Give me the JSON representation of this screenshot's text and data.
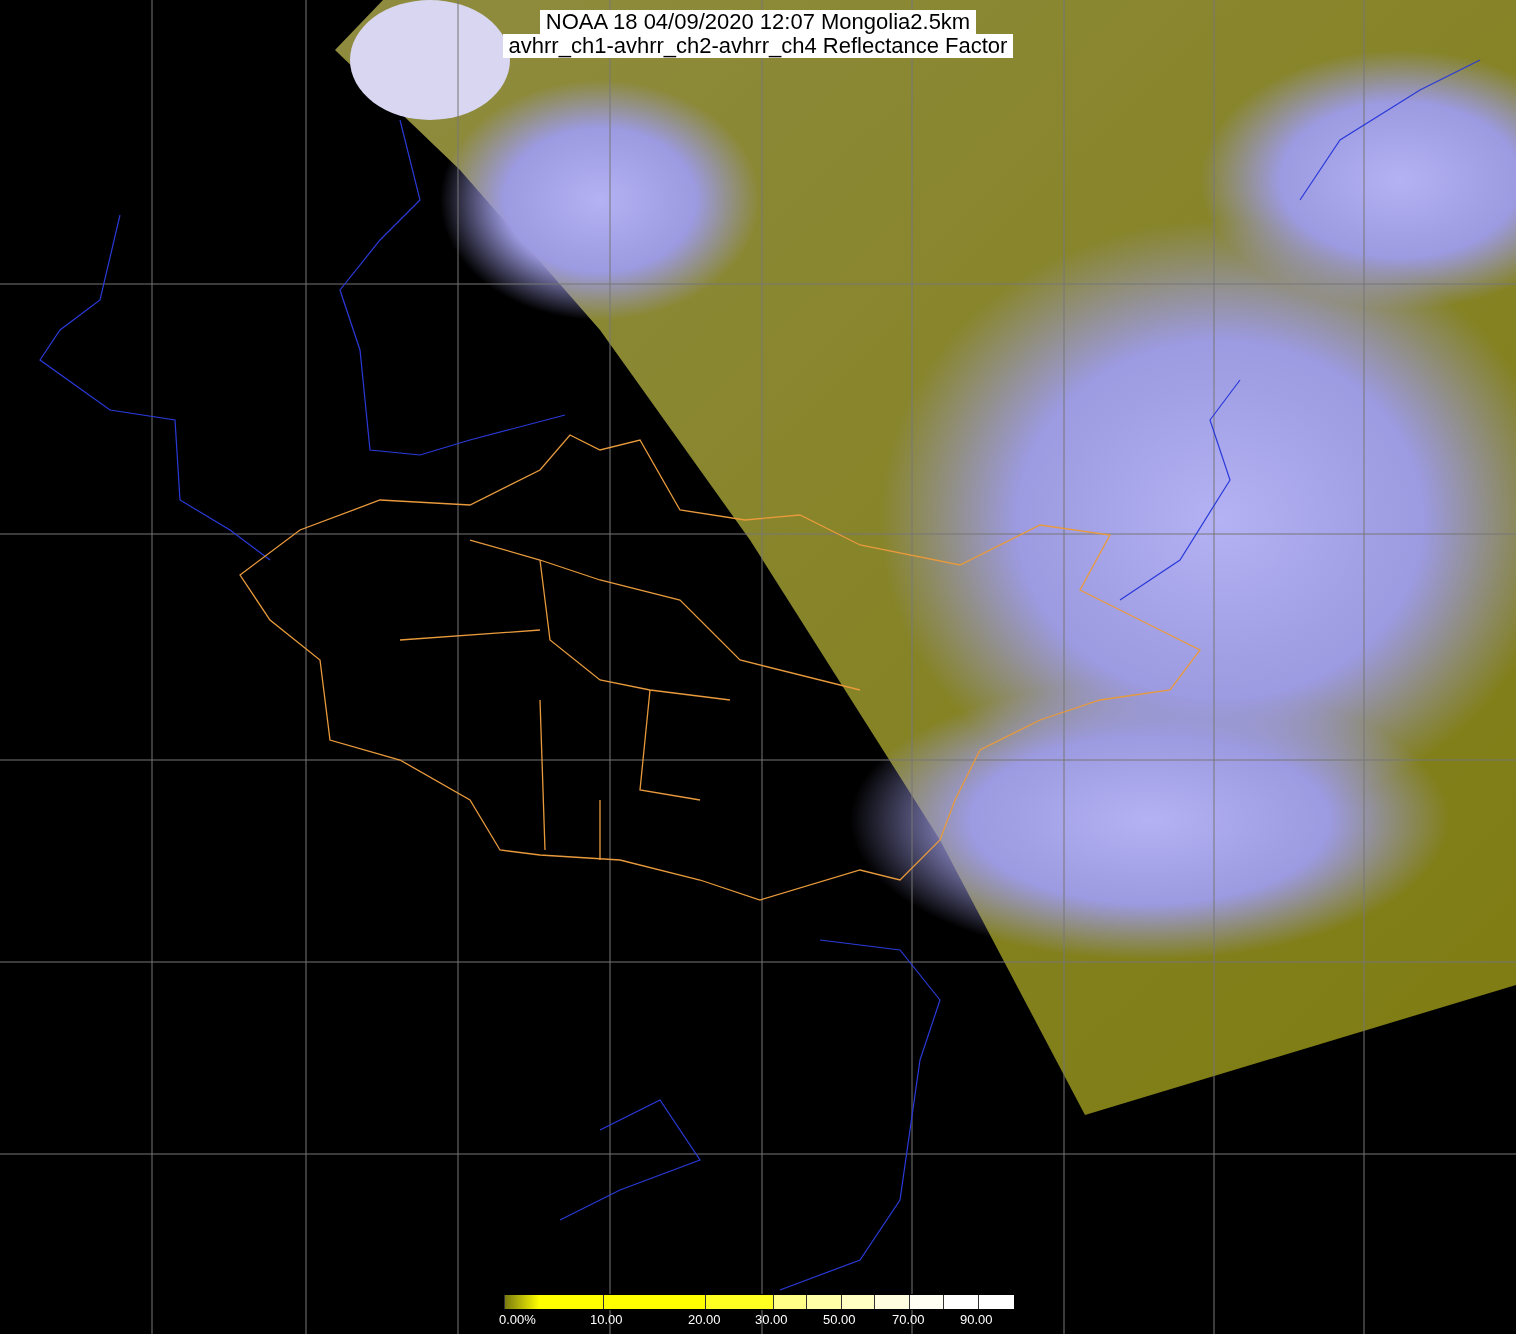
{
  "title": {
    "line_1": "NOAA 18 04/09/2020 12:07 Mongolia2.5km",
    "line_2": "avhrr_ch1-avhrr_ch2-avhrr_ch4 Reflectance Factor"
  },
  "colorbar": {
    "segments": [
      {
        "color": "#ffff00"
      },
      {
        "color": "#ffff00"
      },
      {
        "color": "#ffff22"
      },
      {
        "color": "#ffff88"
      },
      {
        "color": "#ffffa8"
      },
      {
        "color": "#ffffc4"
      },
      {
        "color": "#ffffe0"
      },
      {
        "color": "#fffff4"
      },
      {
        "color": "#ffffff"
      },
      {
        "color": "#ffffff"
      }
    ],
    "labels": [
      "0.00%",
      "10.00",
      "20.00",
      "30.00",
      "50.00",
      "70.00",
      "90.00"
    ]
  }
}
